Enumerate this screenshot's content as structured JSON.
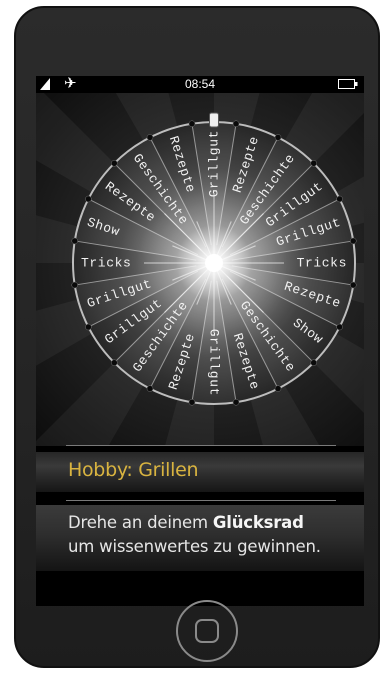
{
  "status": {
    "time": "08:54",
    "icons": [
      "signal-icon",
      "airplane-icon",
      "battery-icon"
    ]
  },
  "wheel": {
    "segments": [
      "Grillgut",
      "Rezepte",
      "Geschichte",
      "Grillgut",
      "Grillgut",
      "Tricks",
      "Rezepte",
      "Show",
      "Geschichte",
      "Rezepte",
      "Grillgut",
      "Rezepte",
      "Geschichte",
      "Grillgut",
      "Grillgut",
      "Tricks",
      "Show",
      "Rezepte",
      "Geschichte",
      "Rezepte"
    ],
    "pointer_icon": "pointer-icon"
  },
  "content": {
    "title": "Hobby: Grillen",
    "desc_before": "Drehe an deinem ",
    "desc_bold": "Glücksrad",
    "desc_after": "um wissenwertes zu gewinnen."
  },
  "home_button": {
    "icon": "home-button-icon"
  },
  "colors": {
    "title": "#d9b440",
    "text": "#e6e6e6",
    "phone": "#262626"
  }
}
